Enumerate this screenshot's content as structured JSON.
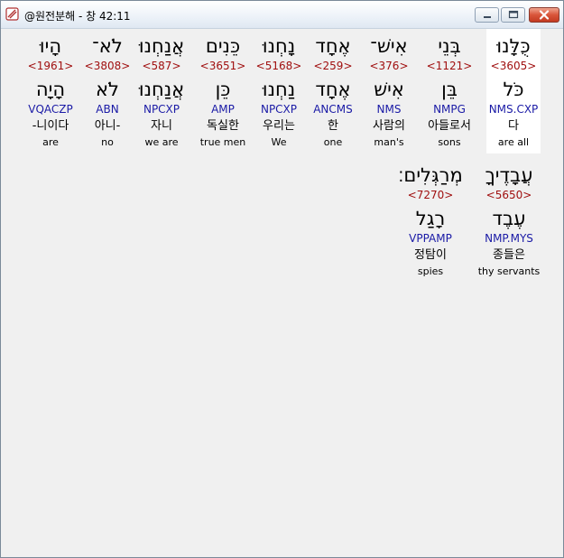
{
  "window": {
    "title": "@원전분해 - 창 42:11"
  },
  "row1": [
    {
      "heb": "כֻּלָּנוּ",
      "strong": "<3605>",
      "lemma": "כֹּל",
      "morph": "NMS.CXP",
      "kor": "다",
      "eng": "are all",
      "selected": true
    },
    {
      "heb": "בְּנֵי",
      "strong": "<1121>",
      "lemma": "בֵּן",
      "morph": "NMPG",
      "kor": "아들로서",
      "eng": "sons"
    },
    {
      "heb": "אִישׁ־",
      "strong": "<376>",
      "lemma": "אִישׁ",
      "morph": "NMS",
      "kor": "사람의",
      "eng": "man's"
    },
    {
      "heb": "אֶחָד",
      "strong": "<259>",
      "lemma": "אֶחָד",
      "morph": "ANCMS",
      "kor": "한",
      "eng": "one"
    },
    {
      "heb": "נָחְנוּ",
      "strong": "<5168>",
      "lemma": "נַחְנוּ",
      "morph": "NPCXP",
      "kor": "우리는",
      "eng": "We"
    },
    {
      "heb": "כֵּנִים",
      "strong": "<3651>",
      "lemma": "כֵּן",
      "morph": "AMP",
      "kor": "독실한",
      "eng": "true men"
    },
    {
      "heb": "אֲנַחְנוּ",
      "strong": "<587>",
      "lemma": "אֲנַחְנוּ",
      "morph": "NPCXP",
      "kor": "자니",
      "eng": "we are"
    },
    {
      "heb": "לֹא־",
      "strong": "<3808>",
      "lemma": "לֹא",
      "morph": "ABN",
      "kor": "아니-",
      "eng": "no"
    },
    {
      "heb": "הָיוּ",
      "strong": "<1961>",
      "lemma": "הָיָה",
      "morph": "VQACZP",
      "kor": "-니이다",
      "eng": "are"
    }
  ],
  "row2": [
    {
      "heb": "עֲבָדֶיךָ",
      "strong": "<5650>",
      "lemma": "עֶבֶד",
      "morph": "NMP.MYS",
      "kor": "종들은",
      "eng": "thy servants"
    },
    {
      "heb": "מְרַגְּלִים׃",
      "strong": "<7270>",
      "lemma": "רָגַל",
      "morph": "VPPAMP",
      "kor": "정탐이",
      "eng": "spies"
    }
  ]
}
